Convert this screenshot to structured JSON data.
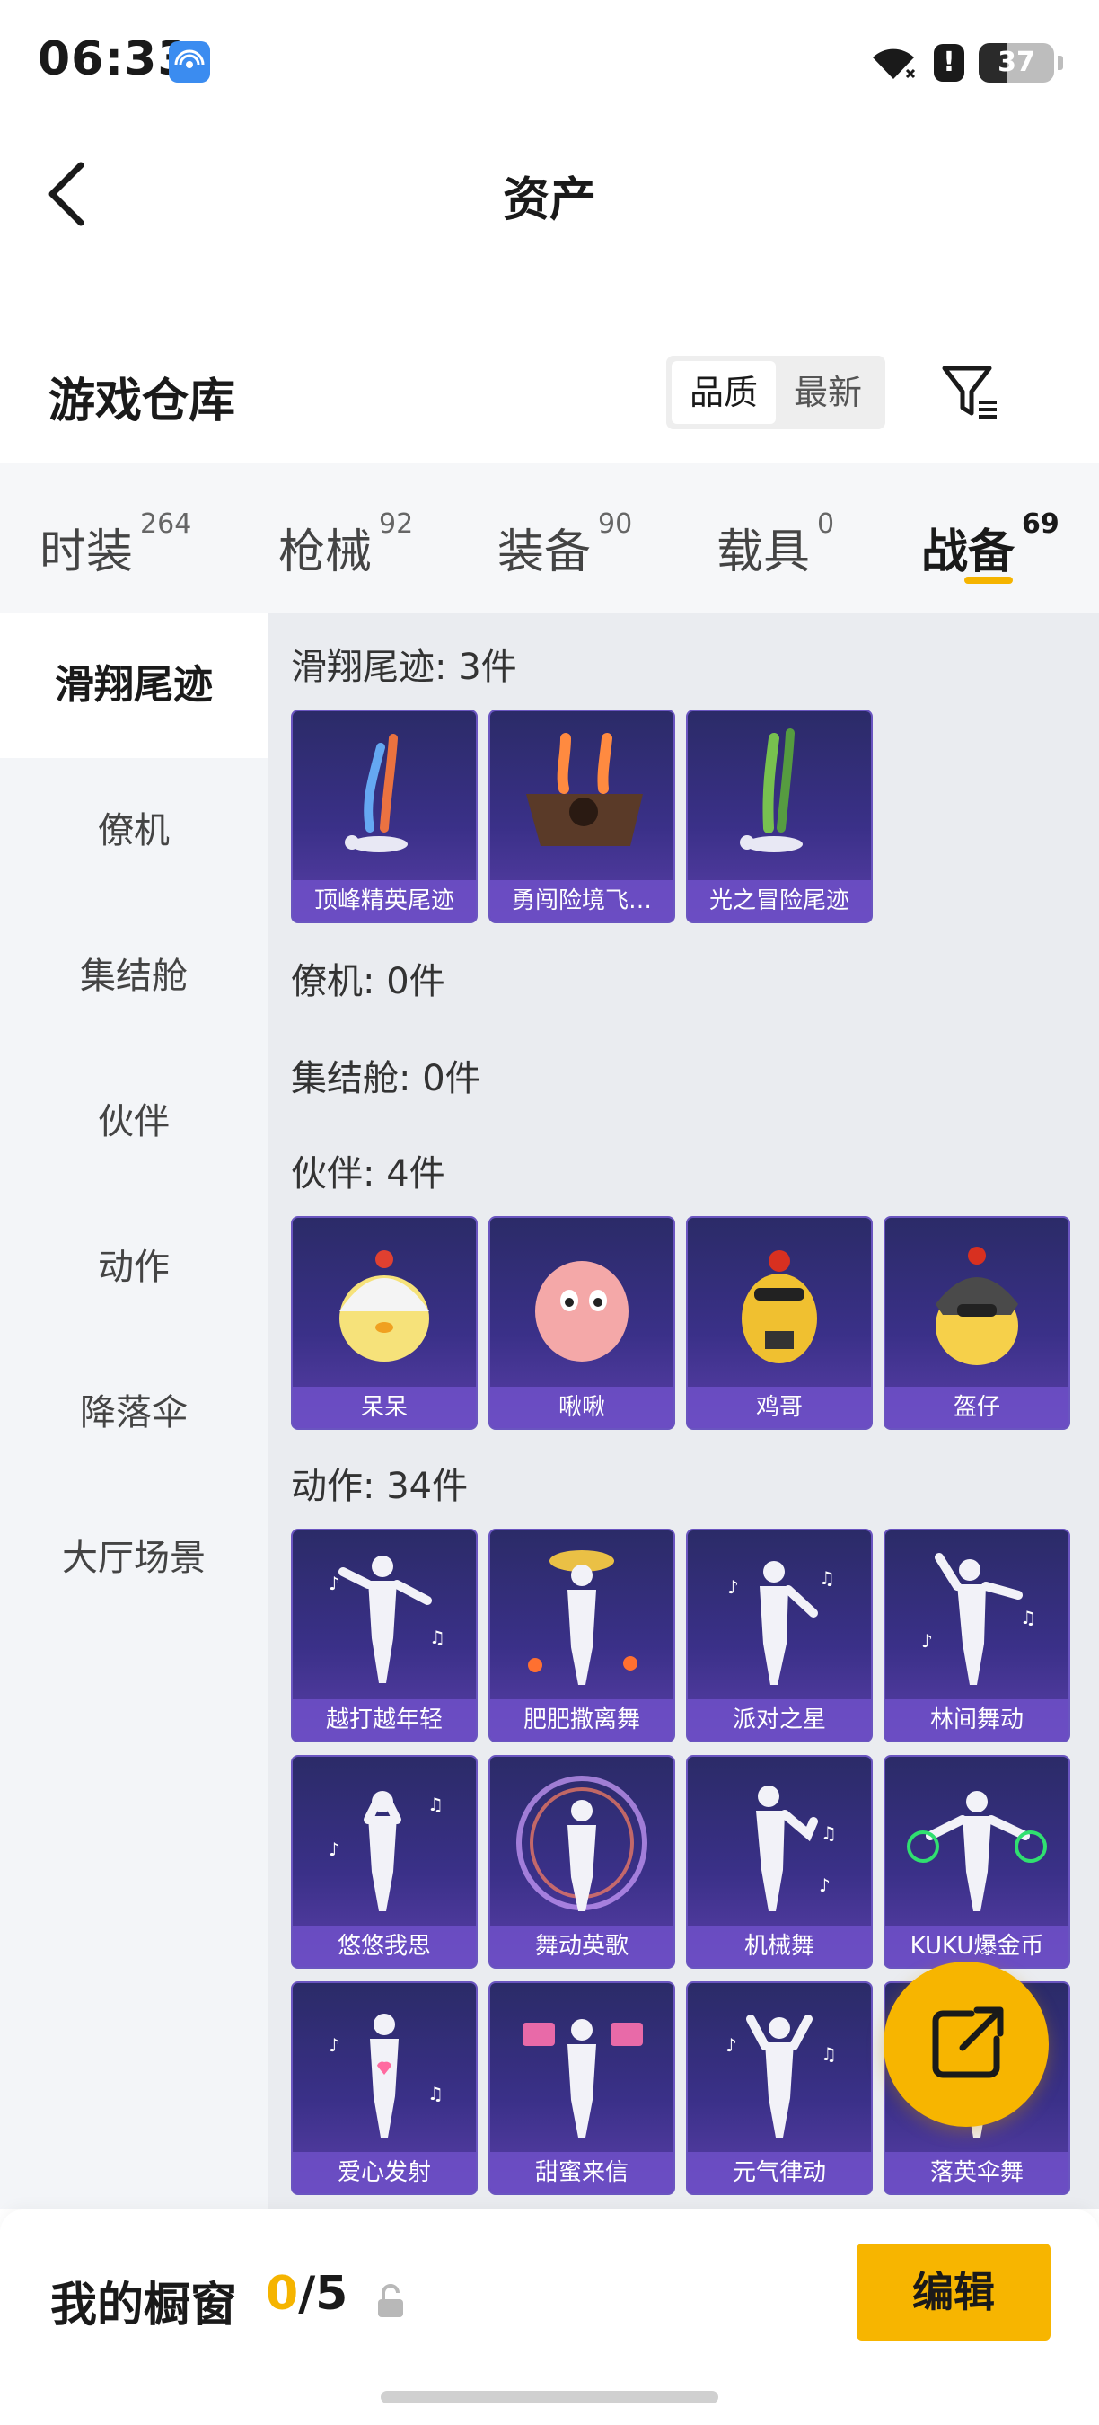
{
  "status_bar": {
    "time": "06:33",
    "battery_level": "37",
    "battery_fraction": 0.37,
    "icons": [
      "app-notification-icon",
      "wifi-icon",
      "alert-icon",
      "battery-icon"
    ]
  },
  "header": {
    "title": "资产",
    "back_icon": "chevron-left-icon"
  },
  "warehouse": {
    "title": "游戏仓库",
    "sort_options": [
      "品质",
      "最新"
    ],
    "sort_selected": "品质",
    "filter_icon": "filter-icon"
  },
  "tabs": [
    {
      "label": "时装",
      "count": "264",
      "active": false
    },
    {
      "label": "枪械",
      "count": "92",
      "active": false
    },
    {
      "label": "装备",
      "count": "90",
      "active": false
    },
    {
      "label": "载具",
      "count": "0",
      "active": false
    },
    {
      "label": "战备",
      "count": "69",
      "active": true
    }
  ],
  "sidebar": {
    "items": [
      {
        "label": "滑翔尾迹",
        "active": true
      },
      {
        "label": "僚机",
        "active": false
      },
      {
        "label": "集结舱",
        "active": false
      },
      {
        "label": "伙伴",
        "active": false
      },
      {
        "label": "动作",
        "active": false
      },
      {
        "label": "降落伞",
        "active": false
      },
      {
        "label": "大厅场景",
        "active": false
      }
    ]
  },
  "groups": [
    {
      "title": "滑翔尾迹: 3件",
      "items": [
        "顶峰精英尾迹",
        "勇闯险境飞…",
        "光之冒险尾迹"
      ]
    },
    {
      "title": "僚机: 0件",
      "items": []
    },
    {
      "title": "集结舱: 0件",
      "items": []
    },
    {
      "title": "伙伴: 4件",
      "items": [
        "呆呆",
        "啾啾",
        "鸡哥",
        "盔仔"
      ]
    },
    {
      "title": "动作: 34件",
      "items": [
        "越打越年轻",
        "肥肥撒离舞",
        "派对之星",
        "林间舞动",
        "悠悠我思",
        "舞动英歌",
        "机械舞",
        "KUKU爆金币",
        "爱心发射",
        "甜蜜来信",
        "元气律动",
        "落英伞舞"
      ]
    }
  ],
  "share_fab_icon": "share-icon",
  "bottom_bar": {
    "label": "我的橱窗",
    "count_current": "0",
    "count_total": "/5",
    "lock_icon": "lock-icon",
    "edit_label": "编辑"
  },
  "colors": {
    "accent": "#f7b500",
    "card_gradient_top": "#2b2b68",
    "card_gradient_bottom": "#5a3fa8"
  }
}
